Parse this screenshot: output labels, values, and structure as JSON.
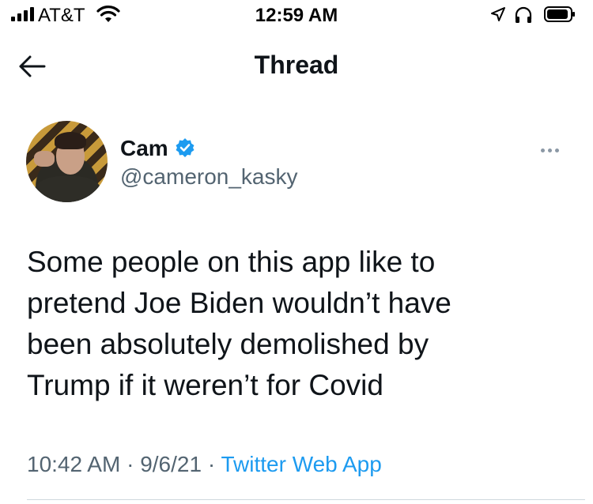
{
  "status_bar": {
    "carrier": "AT&T",
    "time": "12:59 AM"
  },
  "header": {
    "title": "Thread"
  },
  "tweet": {
    "display_name": "Cam",
    "handle": "@cameron_kasky",
    "verified": true,
    "text": "Some people on this app like to\npretend Joe Biden wouldn’t have\nbeen absolutely demolished by\nTrump if it weren’t for Covid",
    "time": "10:42 AM",
    "date": "9/6/21",
    "source": "Twitter Web App",
    "separator": "·"
  },
  "colors": {
    "verified_blue": "#1d9bf0",
    "secondary_text": "#536471",
    "link_blue": "#1d9bf0"
  },
  "icons": {
    "back": "arrow-left-icon",
    "more": "more-horizontal-icon",
    "verified": "verified-badge-icon",
    "wifi": "wifi-icon",
    "location": "location-arrow-icon",
    "headphones": "headphones-icon",
    "battery": "battery-icon",
    "signal": "cellular-signal-icon"
  }
}
